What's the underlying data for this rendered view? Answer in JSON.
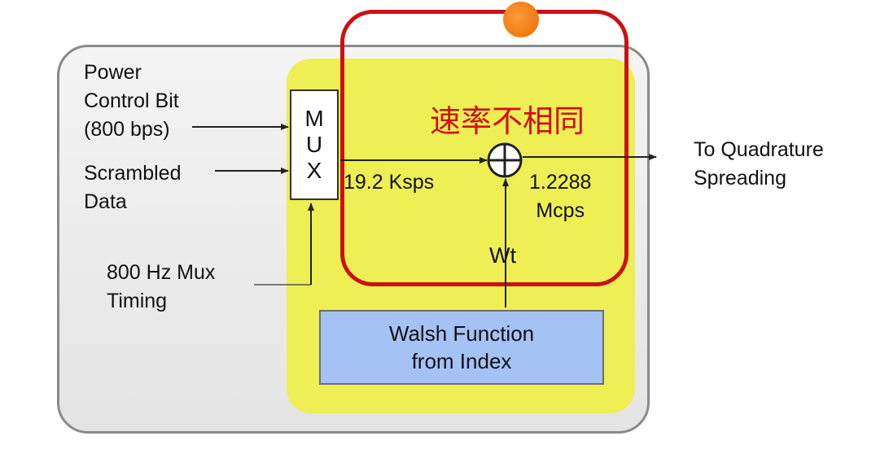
{
  "diagram": {
    "inputs": {
      "power_control": [
        "Power",
        "Control Bit",
        "(800 bps)"
      ],
      "scrambled": [
        "Scrambled",
        "Data"
      ],
      "timing": [
        "800 Hz Mux",
        "Timing"
      ]
    },
    "mux_letters": [
      "M",
      "U",
      "X"
    ],
    "mux_rate": "19.2 Ksps",
    "chip_rate": [
      "1.2288",
      "Mcps"
    ],
    "wt_label": "Wt",
    "walsh": [
      "Walsh Function",
      "from Index"
    ],
    "output": [
      "To Quadrature",
      "Spreading"
    ],
    "annotation": "速率不相同"
  },
  "colors": {
    "yellow_region": "#eeee55",
    "red_frame": "#cc1111",
    "walsh_box": "#a4c2f4",
    "orange_dot": "#f07a10"
  }
}
